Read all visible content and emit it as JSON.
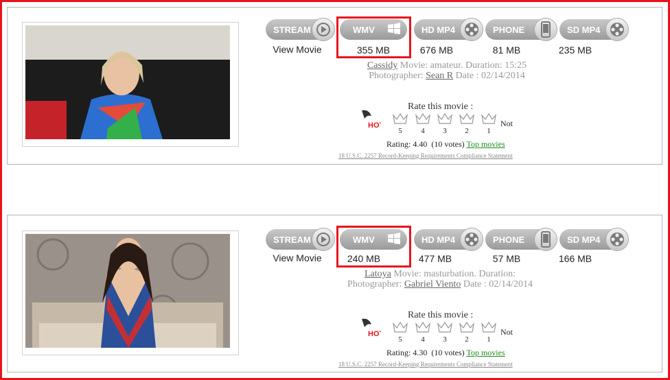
{
  "colors": {
    "highlight": "#e8141c",
    "button": "#a9a9a9",
    "top_link": "#1a8a1a"
  },
  "labels": {
    "stream": "STREAM",
    "wmv": "WMV",
    "hd_mp4": "HD MP4",
    "phone": "PHONE",
    "sd_mp4": "SD MP4",
    "view_movie": "View Movie",
    "movie_prefix": "Movie:",
    "duration_prefix": "Duration:",
    "photographer_prefix": "Photographer:",
    "date_prefix": "Date :",
    "rate_title": "Rate this movie :",
    "not": "Not",
    "rating_prefix": "Rating:",
    "top_movies": "Top movies",
    "legal": "18 U.S.C. 2257 Record-Keeping Requirements Compliance Statement",
    "hot": "HOT"
  },
  "icons": {
    "stream": "play-icon",
    "wmv": "windows-icon",
    "hd_mp4": "film-reel-icon",
    "phone": "phone-icon",
    "sd_mp4": "film-reel-icon"
  },
  "star_values": [
    "5",
    "4",
    "3",
    "2",
    "1"
  ],
  "movies": [
    {
      "model": "Cassidy",
      "category": "amateur.",
      "duration": "15:25",
      "photographer": "Sean R",
      "date": "02/14/2014",
      "sizes": {
        "wmv": "355 MB",
        "hd_mp4": "676 MB",
        "phone": "81 MB",
        "sd_mp4": "235 MB"
      },
      "rating": "4.40",
      "votes": "(10 votes)"
    },
    {
      "model": "Latoya",
      "category": "masturbation.",
      "duration": "",
      "photographer": "Gabriel Viento",
      "date": "02/14/2014",
      "sizes": {
        "wmv": "240 MB",
        "hd_mp4": "477 MB",
        "phone": "57 MB",
        "sd_mp4": "166 MB"
      },
      "rating": "4.30",
      "votes": "(10 votes)"
    }
  ]
}
